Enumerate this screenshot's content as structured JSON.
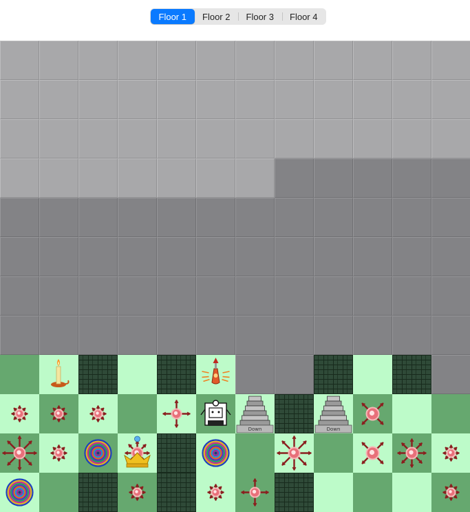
{
  "floor_selector": {
    "selected_index": 0,
    "tabs": [
      "Floor 1",
      "Floor 2",
      "Floor 3",
      "Floor 4"
    ]
  },
  "colors": {
    "segment_selected": "#0a7aff",
    "fog_light": "#a8a8aa",
    "fog_dark": "#838386",
    "floor_light": "#bdfbc9",
    "floor_dark": "#66a86f",
    "wall": "#2f4a38"
  },
  "board": {
    "columns": 12,
    "rows": 12,
    "legend": {
      "L": "fog-light",
      "D": "fog-dark",
      "g": "green-light",
      "G": "green-dark",
      "W": "wall"
    },
    "layout": [
      "LLLLLLLLLLLL",
      "LLLLLLLLLLLL",
      "LLLLLLLLLLLL",
      "LLLLLLLDDDDD",
      "DDDDDDDDDDDD",
      "DDDDDDDDDDDD",
      "DDDDDDDDDDDD",
      "DDDDDDDDDDDD",
      "GgWgWgDDWgWD",
      "gGgGgGgWgGgG",
      "GgGgWgGgGgGg",
      "gGWGWgGWgGgG"
    ],
    "items": [
      {
        "row": 8,
        "col": 1,
        "icon": "candle-icon"
      },
      {
        "row": 8,
        "col": 5,
        "icon": "potion-icon"
      },
      {
        "row": 9,
        "col": 0,
        "icon": "monster-small-icon"
      },
      {
        "row": 9,
        "col": 1,
        "icon": "monster-small-icon"
      },
      {
        "row": 9,
        "col": 2,
        "icon": "monster-small-icon"
      },
      {
        "row": 9,
        "col": 4,
        "icon": "monster-cross-icon"
      },
      {
        "row": 9,
        "col": 5,
        "icon": "robot-icon"
      },
      {
        "row": 9,
        "col": 6,
        "icon": "stairs-down-icon",
        "label": "Down"
      },
      {
        "row": 9,
        "col": 8,
        "icon": "stairs-down-icon",
        "label": "Down"
      },
      {
        "row": 9,
        "col": 9,
        "icon": "monster-diagonal-icon"
      },
      {
        "row": 10,
        "col": 0,
        "icon": "monster-large-icon"
      },
      {
        "row": 10,
        "col": 1,
        "icon": "monster-small-icon"
      },
      {
        "row": 10,
        "col": 2,
        "icon": "vortex-icon"
      },
      {
        "row": 10,
        "col": 3,
        "icon": "crown-monster-icon"
      },
      {
        "row": 10,
        "col": 5,
        "icon": "vortex-icon"
      },
      {
        "row": 10,
        "col": 7,
        "icon": "monster-large-icon"
      },
      {
        "row": 10,
        "col": 9,
        "icon": "monster-diagonal-icon"
      },
      {
        "row": 10,
        "col": 10,
        "icon": "monster-star-icon"
      },
      {
        "row": 10,
        "col": 11,
        "icon": "monster-small-icon"
      },
      {
        "row": 11,
        "col": 0,
        "icon": "vortex-icon"
      },
      {
        "row": 11,
        "col": 3,
        "icon": "monster-small-icon"
      },
      {
        "row": 11,
        "col": 5,
        "icon": "monster-small-icon"
      },
      {
        "row": 11,
        "col": 6,
        "icon": "monster-cross-icon"
      },
      {
        "row": 11,
        "col": 11,
        "icon": "monster-small-icon"
      }
    ]
  }
}
